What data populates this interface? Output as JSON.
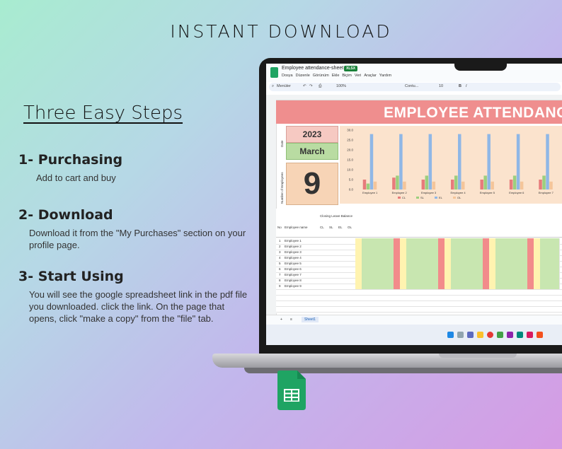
{
  "heading": "INSTANT DOWNLOAD",
  "steps_title": "Three Easy Steps",
  "steps": [
    {
      "title": "1- Purchasing",
      "text": "Add to cart and buy"
    },
    {
      "title": "2- Download",
      "text": "Download it from the \"My Purchases\" section on your profile page."
    },
    {
      "title": "3- Start Using",
      "text": "You will see the google spreadsheet link in the pdf file you downloaded. click the link. On the page that opens, click \"make a copy\" from the \"file\" tab."
    }
  ],
  "sheet": {
    "doc_title": "Employee attendance-sheet",
    "badge": "XLSX",
    "menus": [
      "Dosya",
      "Düzenle",
      "Görünüm",
      "Ekle",
      "Biçim",
      "Veri",
      "Araçlar",
      "Yardım"
    ],
    "toolbar": {
      "menus_label": "Menüler",
      "zoom": "100%",
      "font": "Contu...",
      "font_size": "10"
    },
    "banner": "EMPLOYEE ATTENDANCE",
    "date_label": "Date",
    "year": "2023",
    "month": "March",
    "employees_label": "Number of Employees",
    "employee_count": "9",
    "table_headers": {
      "no": "No",
      "name": "Employee name",
      "balance": "Closing Leave Balance",
      "cl": "CL",
      "sl": "SL",
      "el": "EL",
      "ol": "OL"
    },
    "employees": [
      "Employee 1",
      "Employee 2",
      "Employee 3",
      "Employee 4",
      "Employee 5",
      "Employee 6",
      "Employee 7",
      "Employee 8",
      "Employee 9"
    ],
    "sheet_tab": "Sheet1"
  },
  "chart_data": {
    "type": "bar",
    "categories": [
      "Employee 1",
      "Employee 2",
      "Employee 3",
      "Employee 4",
      "Employee 5",
      "Employee 6",
      "Employee 7"
    ],
    "series": [
      {
        "name": "CL",
        "color": "#e77b7b",
        "values": [
          5,
          6,
          5,
          5,
          5,
          5,
          5
        ]
      },
      {
        "name": "SL",
        "color": "#9ccf7e",
        "values": [
          3,
          7,
          7,
          7,
          7,
          7,
          7
        ]
      },
      {
        "name": "EL",
        "color": "#8fb7e6",
        "values": [
          28,
          28,
          28,
          28,
          28,
          28,
          28
        ]
      },
      {
        "name": "OL",
        "color": "#f4c59a",
        "values": [
          4,
          4,
          4,
          4,
          4,
          4,
          4
        ]
      }
    ],
    "yticks": [
      "0.0",
      "5.0",
      "10.0",
      "15.0",
      "20.0",
      "25.0",
      "30.0"
    ],
    "ylim": [
      0,
      30
    ]
  },
  "colors": {
    "banner": "#ef8e8e",
    "sheets_green": "#1fa463"
  }
}
